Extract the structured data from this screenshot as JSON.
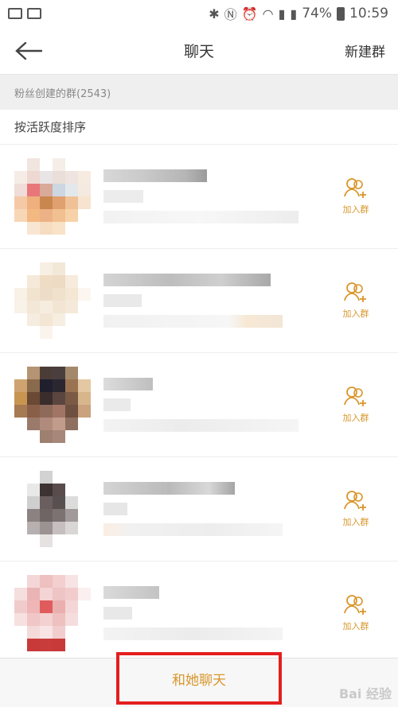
{
  "statusbar": {
    "battery": "74%",
    "time": "10:59"
  },
  "header": {
    "title": "聊天",
    "new_group_label": "新建群"
  },
  "section": {
    "label": "粉丝创建的群(2543)"
  },
  "sort": {
    "label": "按活跃度排序"
  },
  "groups": [
    {
      "join_label": "加入群"
    },
    {
      "join_label": "加入群"
    },
    {
      "join_label": "加入群"
    },
    {
      "join_label": "加入群"
    },
    {
      "join_label": "加入群"
    }
  ],
  "bottom": {
    "chat_label": "和她聊天"
  },
  "watermark": "Bai 经验",
  "colors": {
    "accent": "#d9962b",
    "highlight": "#e41f1f"
  }
}
